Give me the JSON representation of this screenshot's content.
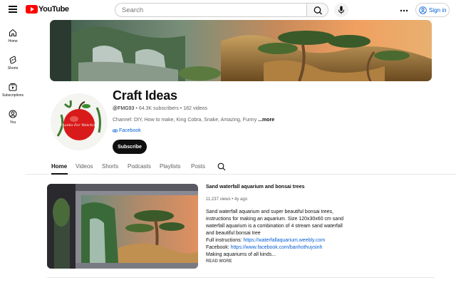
{
  "header": {
    "logo_text": "YouTube",
    "search_placeholder": "Search",
    "signin_label": "Sign in"
  },
  "sidebar": {
    "items": [
      {
        "label": "Home",
        "icon": "home-icon"
      },
      {
        "label": "Shorts",
        "icon": "shorts-icon"
      },
      {
        "label": "Subscriptions",
        "icon": "subscriptions-icon"
      },
      {
        "label": "You",
        "icon": "you-icon"
      }
    ]
  },
  "channel": {
    "name": "Craft Ideas",
    "handle": "@FMG93",
    "subscribers": "64.3K subscribers",
    "videos": "182 videos",
    "description": "Channel: DIY, How to make, King Cobra, Snake, Amazing, Funny ",
    "more_label": "...more",
    "link_label": "Facebook",
    "subscribe_label": "Subscribe",
    "avatar_text": "Thanks For Watching"
  },
  "tabs": [
    "Home",
    "Videos",
    "Shorts",
    "Podcasts",
    "Playlists",
    "Posts"
  ],
  "featured": {
    "title": "Sand waterfall aquarium and bonsai trees",
    "views": "11,237 views",
    "age": "4y ago",
    "desc_line1": "Sand waterfall aquarium and super beautiful bonsai trees, instructions for making an aquarium. Size 120x30x60 cm sand waterfall aquarium is a combination of 4 stream sand waterfall and beautiful bonsai tree",
    "instructions_prefix": "Full instructions: ",
    "instructions_link": "https://waterfallaquarium.weebly.com",
    "facebook_prefix": "Facebook: ",
    "facebook_link": "https://www.facebook.com/banhothuysinh",
    "desc_line_last": "Making aquariums of all kinds...",
    "read_more": "READ MORE"
  },
  "colors": {
    "brand_red": "#ff0000",
    "link_blue": "#065fd4",
    "text_primary": "#0f0f0f",
    "text_secondary": "#606060"
  }
}
